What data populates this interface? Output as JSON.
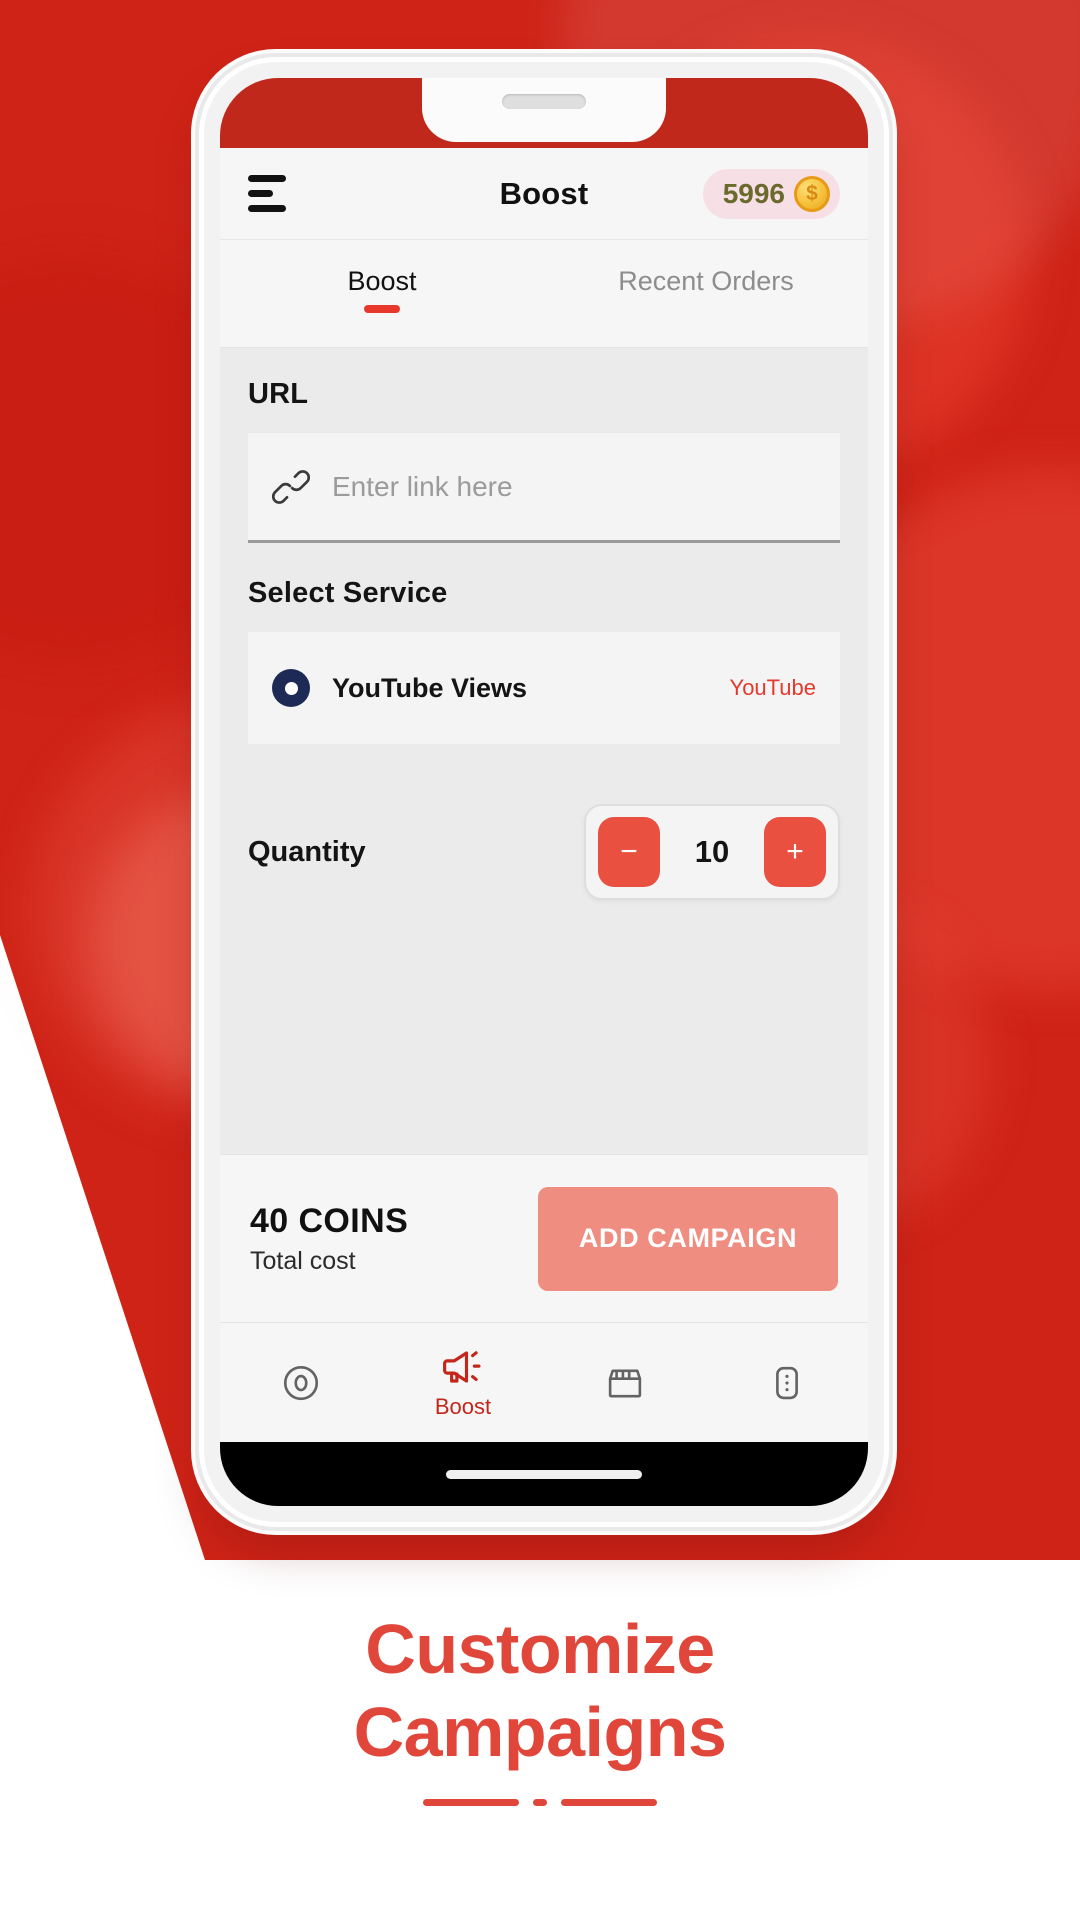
{
  "app": {
    "title": "Boost",
    "menu_icon": "hamburger-icon",
    "coins": {
      "value": "5996",
      "icon": "coin-icon",
      "symbol": "$"
    }
  },
  "tabs": [
    {
      "label": "Boost",
      "active": true
    },
    {
      "label": "Recent Orders",
      "active": false
    }
  ],
  "form": {
    "url": {
      "label": "URL",
      "placeholder": "Enter link here",
      "value": "",
      "icon": "link-icon"
    },
    "service": {
      "label": "Select Service",
      "name": "YouTube Views",
      "platform": "YouTube",
      "icon": "eye-view-icon"
    },
    "quantity": {
      "label": "Quantity",
      "value": "10",
      "decrement": "−",
      "increment": "+"
    }
  },
  "cost_bar": {
    "amount": "40 COINS",
    "caption": "Total cost",
    "action_label": "ADD CAMPAIGN"
  },
  "bottom_nav": [
    {
      "label": "",
      "icon": "coin-circle-icon",
      "active": false
    },
    {
      "label": "Boost",
      "icon": "megaphone-icon",
      "active": true
    },
    {
      "label": "",
      "icon": "store-icon",
      "active": false
    },
    {
      "label": "",
      "icon": "more-vertical-icon",
      "active": false
    }
  ],
  "promo": {
    "line1": "Customize",
    "line2": "Campaigns"
  },
  "colors": {
    "background_red": "#cf2317",
    "accent_red": "#e8382c",
    "button_salmon": "#ef8d80",
    "stepper_red": "#e9503f",
    "coin_pill": "#f7dfe6",
    "coin_text": "#6b6a2d",
    "service_icon_navy": "#1d2a56",
    "caption_red": "#e0473a"
  }
}
